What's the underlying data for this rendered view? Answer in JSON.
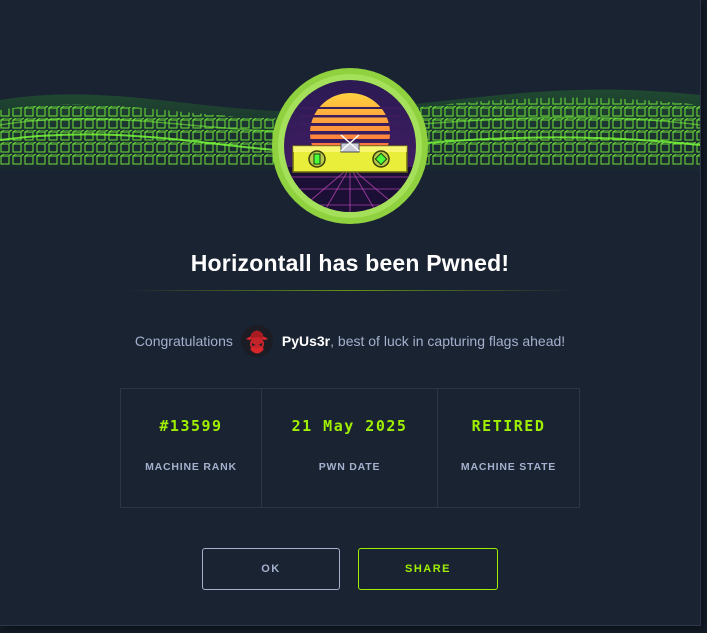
{
  "modal": {
    "title": "Horizontall has been Pwned!",
    "congrats_prefix": "Congratulations",
    "username": "PyUs3r",
    "congrats_suffix": ", best of luck in capturing flags ahead!"
  },
  "stats": [
    {
      "value": "#13599",
      "label": "MACHINE RANK"
    },
    {
      "value": "21 May 2025",
      "label": "PWN DATE"
    },
    {
      "value": "RETIRED",
      "label": "MACHINE STATE"
    }
  ],
  "buttons": {
    "ok_label": "OK",
    "share_label": "SHARE"
  },
  "colors": {
    "background": "#1a2332",
    "accent": "#9fef00",
    "muted_text": "#a4b1cd",
    "heading": "#ffffff"
  },
  "icons": {
    "machine_badge": "machine-avatar-icon",
    "user_avatar": "hacker-avatar-icon"
  }
}
